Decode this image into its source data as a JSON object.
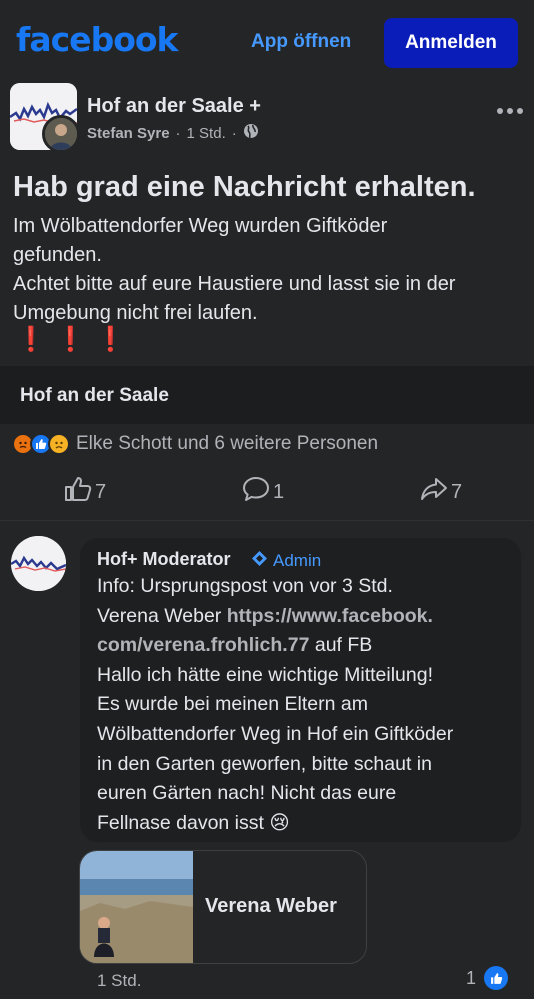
{
  "topbar": {
    "logo": "facebook",
    "open_app": "App öffnen",
    "login": "Anmelden"
  },
  "post": {
    "group_name": "Hof an der Saale +",
    "author": "Stefan Syre",
    "separator": "·",
    "time": "1 Std.",
    "headline": "Hab grad eine Nachricht erhalten.",
    "body_lines": [
      "Im Wölbattendorfer Weg wurden Giftköder",
      "gefunden.",
      "Achtet bitte auf eure Haustiere und lasst sie in der",
      "Umgebung nicht frei laufen."
    ],
    "bangs": "❗❗❗",
    "group_bar_label": "Hof an der Saale",
    "reactions_text": "Elke Schott und 6 weitere Personen",
    "like_count": "7",
    "comment_count": "1",
    "share_count": "7"
  },
  "comment": {
    "author": "Hof+ Moderator",
    "badge": "Admin",
    "lines": [
      "Info: Ursprungspost von vor 3 Std.",
      "Verena Weber",
      "https://www.facebook.",
      "com/verena.frohlich.77",
      "auf FB",
      "Hallo ich hätte eine wichtige Mitteilung!",
      "Es wurde bei meinen Eltern am",
      "Wölbattendorfer Weg in Hof ein Giftköder",
      "in den Garten geworfen, bitte schaut in",
      "euren Gärten nach! Nicht das eure",
      "Fellnase davon isst"
    ],
    "emoji": "😢",
    "link_card_title": "Verena Weber",
    "time": "1 Std.",
    "likes": "1"
  },
  "icons": {
    "like": "thumbs-up-icon",
    "comment": "comment-bubble-icon",
    "share": "share-arrow-icon",
    "globe": "globe-icon",
    "more": "more-dots-icon",
    "admin": "diamond-admin-icon"
  },
  "colors": {
    "background": "#242526",
    "brand": "#1877f2",
    "login_button": "#0a1db8",
    "link_blue": "#4599ff",
    "alert_red": "#e0245e"
  }
}
